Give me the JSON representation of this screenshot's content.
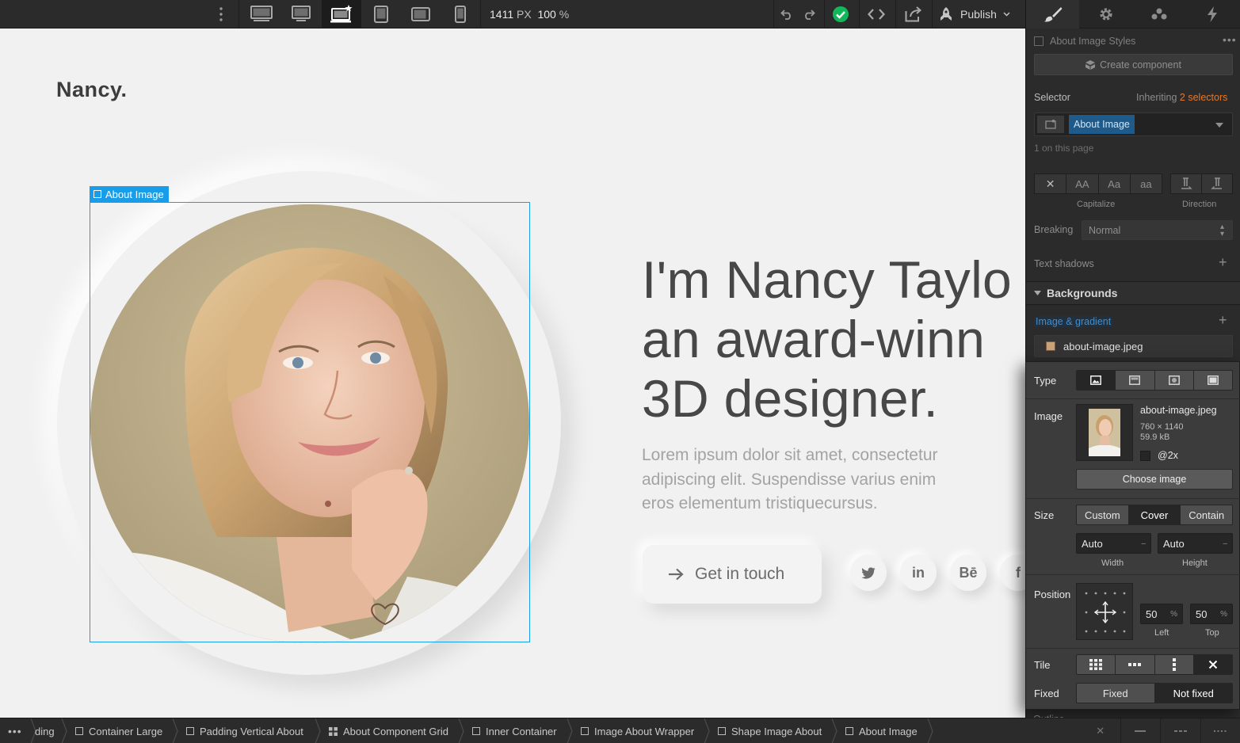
{
  "toolbar": {
    "width_value": "1411",
    "width_unit": "PX",
    "zoom_value": "100",
    "zoom_unit": "%",
    "publish_label": "Publish",
    "devices": [
      "desktop-large-icon",
      "desktop-icon",
      "laptop-base-icon",
      "tablet-icon",
      "tablet-landscape-icon",
      "phone-icon"
    ],
    "status_color": "#12b75b"
  },
  "canvas": {
    "logo": "Nancy.",
    "selection_label": "About Image",
    "hero_title_lines": [
      "I'm Nancy Taylo",
      "an award-winn",
      "3D designer."
    ],
    "hero_text_lines": [
      "Lorem ipsum dolor sit amet, consectetur",
      "adipiscing elit. Suspendisse varius enim",
      "eros elementum tristiquecursus."
    ],
    "cta_label": "Get in touch",
    "social": [
      "twitter-icon",
      "linkedin-icon",
      "behance-icon",
      "facebook-icon"
    ],
    "social_behance": "Bē",
    "social_linkedin": "in",
    "social_facebook": "f",
    "accent": "#1a9de8"
  },
  "panel": {
    "tabs": [
      "style-brush-icon",
      "settings-gear-icon",
      "interactions-icon",
      "lightning-icon"
    ],
    "component_title": "About Image Styles",
    "create_component": "Create component",
    "selector_label": "Selector",
    "inheriting_prefix": "Inheriting",
    "inheriting_count": "2 selectors",
    "selector_tag": "About Image",
    "on_page": "1 on this page",
    "capitalize_label": "Capitalize",
    "direction_label": "Direction",
    "case_buttons": [
      "AA",
      "Aa",
      "aa"
    ],
    "breaking_label": "Breaking",
    "breaking_value": "Normal",
    "text_shadows_label": "Text shadows",
    "backgrounds_label": "Backgrounds",
    "image_gradient_label": "Image & gradient",
    "bg_file": "about-image.jpeg"
  },
  "popover": {
    "type_label": "Type",
    "image_label": "Image",
    "file_name": "about-image.jpeg",
    "dimensions": "760 × 1140",
    "file_size": "59.9 kB",
    "retina_label": "@2x",
    "choose_image": "Choose image",
    "size_label": "Size",
    "size_options": [
      "Custom",
      "Cover",
      "Contain"
    ],
    "size_selected": "Cover",
    "width_value": "Auto",
    "height_value": "Auto",
    "width_label": "Width",
    "height_label": "Height",
    "position_label": "Position",
    "left_value": "50",
    "top_value": "50",
    "pct_unit": "%",
    "left_label": "Left",
    "top_label": "Top",
    "tile_label": "Tile",
    "fixed_label": "Fixed",
    "fixed_options": [
      "Fixed",
      "Not fixed"
    ],
    "fixed_selected": "Not fixed"
  },
  "outline_label": "Outline",
  "breadcrumbs": [
    "ding",
    "Container Large",
    "Padding Vertical About",
    "About Component Grid",
    "Inner Container",
    "Image About Wrapper",
    "Shape Image About",
    "About Image"
  ]
}
